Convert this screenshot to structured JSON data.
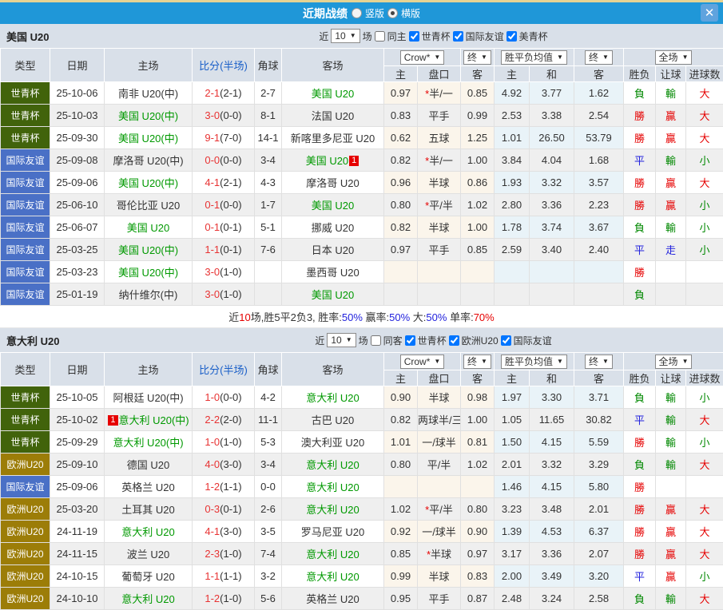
{
  "titlebar": {
    "title": "近期战绩",
    "radios": [
      {
        "label": "竖版",
        "checked": false
      },
      {
        "label": "横版",
        "checked": true
      }
    ],
    "close": "✕"
  },
  "columns": {
    "type": "类型",
    "date": "日期",
    "home": "主场",
    "score": "比分(半场)",
    "corner": "角球",
    "away": "客场",
    "sub": [
      "主",
      "盘口",
      "客",
      "主",
      "和",
      "客",
      "胜负",
      "让球",
      "进球数"
    ],
    "dropdowns": [
      "Crow*",
      "终",
      "胜平负均值",
      "终",
      "全场"
    ]
  },
  "colors": {
    "bar": "#1F97D8",
    "panel": "#D9E0E9",
    "stripe": "#EFEFEF",
    "cream": "#FBF5EB",
    "lightblue": "#E9F3F8",
    "team_green": "#009900",
    "score_red": "#E83333",
    "red": "#E60000",
    "green": "#008800",
    "blue": "#2222DD",
    "black": "#333333",
    "badge": "#E60000"
  },
  "type_colors": {
    "世青杯": "#41630B",
    "国际友谊": "#4A70C6",
    "欧洲U20": "#9C7D08"
  },
  "result_colors": {
    "勝": "red",
    "贏": "red",
    "大": "red",
    "負": "green",
    "輸": "green",
    "小": "green",
    "平": "blue",
    "走": "blue"
  },
  "sections": [
    {
      "team": "美国 U20",
      "filters": {
        "near": "近",
        "count": "10",
        "games": "场",
        "same": "同主",
        "same_checked": false,
        "comps": [
          "世青杯",
          "国际友谊",
          "美青杯"
        ]
      },
      "rows": [
        {
          "type": "世青杯",
          "date": "25-10-06",
          "home": "南非 U20(中)",
          "home_green": false,
          "score": "2-1",
          "half": "(2-1)",
          "corner": "2-7",
          "away": "美国 U20",
          "away_green": true,
          "pan": [
            "0.97",
            "*半/一",
            "0.85"
          ],
          "euro": [
            "4.92",
            "3.77",
            "1.62"
          ],
          "res": [
            "負",
            "輸",
            "大"
          ]
        },
        {
          "type": "世青杯",
          "date": "25-10-03",
          "home": "美国 U20(中)",
          "home_green": true,
          "score": "3-0",
          "half": "(0-0)",
          "corner": "8-1",
          "away": "法国 U20",
          "away_green": false,
          "pan": [
            "0.83",
            "平手",
            "0.99"
          ],
          "euro": [
            "2.53",
            "3.38",
            "2.54"
          ],
          "res": [
            "勝",
            "贏",
            "大"
          ]
        },
        {
          "type": "世青杯",
          "date": "25-09-30",
          "home": "美国 U20(中)",
          "home_green": true,
          "score": "9-1",
          "half": "(7-0)",
          "corner": "14-1",
          "away": "新喀里多尼亚 U20",
          "away_green": false,
          "pan": [
            "0.62",
            "五球",
            "1.25"
          ],
          "euro": [
            "1.01",
            "26.50",
            "53.79"
          ],
          "res": [
            "勝",
            "贏",
            "大"
          ]
        },
        {
          "type": "国际友谊",
          "date": "25-09-08",
          "home": "摩洛哥 U20(中)",
          "home_green": false,
          "score": "0-0",
          "half": "(0-0)",
          "corner": "3-4",
          "away": "美国 U20",
          "away_green": true,
          "away_badge": "1",
          "pan": [
            "0.82",
            "*半/一",
            "1.00"
          ],
          "euro": [
            "3.84",
            "4.04",
            "1.68"
          ],
          "res": [
            "平",
            "輸",
            "小"
          ]
        },
        {
          "type": "国际友谊",
          "date": "25-09-06",
          "home": "美国 U20(中)",
          "home_green": true,
          "score": "4-1",
          "half": "(2-1)",
          "corner": "4-3",
          "away": "摩洛哥 U20",
          "away_green": false,
          "pan": [
            "0.96",
            "半球",
            "0.86"
          ],
          "euro": [
            "1.93",
            "3.32",
            "3.57"
          ],
          "res": [
            "勝",
            "贏",
            "大"
          ]
        },
        {
          "type": "国际友谊",
          "date": "25-06-10",
          "home": "哥伦比亚 U20",
          "home_green": false,
          "score": "0-1",
          "half": "(0-0)",
          "corner": "1-7",
          "away": "美国 U20",
          "away_green": true,
          "pan": [
            "0.80",
            "*平/半",
            "1.02"
          ],
          "euro": [
            "2.80",
            "3.36",
            "2.23"
          ],
          "res": [
            "勝",
            "贏",
            "小"
          ]
        },
        {
          "type": "国际友谊",
          "date": "25-06-07",
          "home": "美国 U20",
          "home_green": true,
          "score": "0-1",
          "half": "(0-1)",
          "corner": "5-1",
          "away": "挪威 U20",
          "away_green": false,
          "pan": [
            "0.82",
            "半球",
            "1.00"
          ],
          "euro": [
            "1.78",
            "3.74",
            "3.67"
          ],
          "res": [
            "負",
            "輸",
            "小"
          ]
        },
        {
          "type": "国际友谊",
          "date": "25-03-25",
          "home": "美国 U20(中)",
          "home_green": true,
          "score": "1-1",
          "half": "(0-1)",
          "corner": "7-6",
          "away": "日本 U20",
          "away_green": false,
          "pan": [
            "0.97",
            "平手",
            "0.85"
          ],
          "euro": [
            "2.59",
            "3.40",
            "2.40"
          ],
          "res": [
            "平",
            "走",
            "小"
          ]
        },
        {
          "type": "国际友谊",
          "date": "25-03-23",
          "home": "美国 U20(中)",
          "home_green": true,
          "score": "3-0",
          "half": "(1-0)",
          "corner": "",
          "away": "墨西哥 U20",
          "away_green": false,
          "pan": [
            "",
            "",
            ""
          ],
          "euro": [
            "",
            "",
            ""
          ],
          "res": [
            "勝",
            "",
            ""
          ]
        },
        {
          "type": "国际友谊",
          "date": "25-01-19",
          "home": "纳什维尔(中)",
          "home_green": false,
          "score": "3-0",
          "half": "(1-0)",
          "corner": "",
          "away": "美国 U20",
          "away_green": true,
          "pan": [
            "",
            "",
            ""
          ],
          "euro": [
            "",
            "",
            ""
          ],
          "res": [
            "負",
            "",
            ""
          ]
        }
      ],
      "summary": [
        {
          "t": "近",
          "c": "black"
        },
        {
          "t": "10",
          "c": "red"
        },
        {
          "t": "场,胜5平2负3, 胜率:",
          "c": "black"
        },
        {
          "t": "50%",
          "c": "blue"
        },
        {
          "t": " 赢率:",
          "c": "black"
        },
        {
          "t": "50%",
          "c": "blue"
        },
        {
          "t": " 大:",
          "c": "black"
        },
        {
          "t": "50%",
          "c": "blue"
        },
        {
          "t": " 单率:",
          "c": "black"
        },
        {
          "t": "70%",
          "c": "red"
        }
      ]
    },
    {
      "team": "意大利 U20",
      "filters": {
        "near": "近",
        "count": "10",
        "games": "场",
        "same": "同客",
        "same_checked": false,
        "comps": [
          "世青杯",
          "欧洲U20",
          "国际友谊"
        ]
      },
      "rows": [
        {
          "type": "世青杯",
          "date": "25-10-05",
          "home": "阿根廷 U20(中)",
          "home_green": false,
          "score": "1-0",
          "half": "(0-0)",
          "corner": "4-2",
          "away": "意大利 U20",
          "away_green": true,
          "pan": [
            "0.90",
            "半球",
            "0.98"
          ],
          "euro": [
            "1.97",
            "3.30",
            "3.71"
          ],
          "res": [
            "負",
            "輸",
            "小"
          ]
        },
        {
          "type": "世青杯",
          "date": "25-10-02",
          "home": "意大利 U20(中)",
          "home_green": true,
          "home_badge": "1",
          "score": "2-2",
          "half": "(2-0)",
          "corner": "11-1",
          "away": "古巴 U20",
          "away_green": false,
          "pan": [
            "0.82",
            "两球半/三",
            "1.00"
          ],
          "euro": [
            "1.05",
            "11.65",
            "30.82"
          ],
          "res": [
            "平",
            "輸",
            "大"
          ]
        },
        {
          "type": "世青杯",
          "date": "25-09-29",
          "home": "意大利 U20(中)",
          "home_green": true,
          "score": "1-0",
          "half": "(1-0)",
          "corner": "5-3",
          "away": "澳大利亚 U20",
          "away_green": false,
          "pan": [
            "1.01",
            "一/球半",
            "0.81"
          ],
          "euro": [
            "1.50",
            "4.15",
            "5.59"
          ],
          "res": [
            "勝",
            "輸",
            "小"
          ]
        },
        {
          "type": "欧洲U20",
          "date": "25-09-10",
          "home": "德国 U20",
          "home_green": false,
          "score": "4-0",
          "half": "(3-0)",
          "corner": "3-4",
          "away": "意大利 U20",
          "away_green": true,
          "pan": [
            "0.80",
            "平/半",
            "1.02"
          ],
          "euro": [
            "2.01",
            "3.32",
            "3.29"
          ],
          "res": [
            "負",
            "輸",
            "大"
          ]
        },
        {
          "type": "国际友谊",
          "date": "25-09-06",
          "home": "英格兰 U20",
          "home_green": false,
          "score": "1-2",
          "half": "(1-1)",
          "corner": "0-0",
          "away": "意大利 U20",
          "away_green": true,
          "pan": [
            "",
            "",
            ""
          ],
          "euro": [
            "1.46",
            "4.15",
            "5.80"
          ],
          "res": [
            "勝",
            "",
            ""
          ]
        },
        {
          "type": "欧洲U20",
          "date": "25-03-20",
          "home": "土耳其 U20",
          "home_green": false,
          "score": "0-3",
          "half": "(0-1)",
          "corner": "2-6",
          "away": "意大利 U20",
          "away_green": true,
          "pan": [
            "1.02",
            "*平/半",
            "0.80"
          ],
          "euro": [
            "3.23",
            "3.48",
            "2.01"
          ],
          "res": [
            "勝",
            "贏",
            "大"
          ]
        },
        {
          "type": "欧洲U20",
          "date": "24-11-19",
          "home": "意大利 U20",
          "home_green": true,
          "score": "4-1",
          "half": "(3-0)",
          "corner": "3-5",
          "away": "罗马尼亚 U20",
          "away_green": false,
          "pan": [
            "0.92",
            "一/球半",
            "0.90"
          ],
          "euro": [
            "1.39",
            "4.53",
            "6.37"
          ],
          "res": [
            "勝",
            "贏",
            "大"
          ]
        },
        {
          "type": "欧洲U20",
          "date": "24-11-15",
          "home": "波兰 U20",
          "home_green": false,
          "score": "2-3",
          "half": "(1-0)",
          "corner": "7-4",
          "away": "意大利 U20",
          "away_green": true,
          "pan": [
            "0.85",
            "*半球",
            "0.97"
          ],
          "euro": [
            "3.17",
            "3.36",
            "2.07"
          ],
          "res": [
            "勝",
            "贏",
            "大"
          ]
        },
        {
          "type": "欧洲U20",
          "date": "24-10-15",
          "home": "葡萄牙 U20",
          "home_green": false,
          "score": "1-1",
          "half": "(1-1)",
          "corner": "3-2",
          "away": "意大利 U20",
          "away_green": true,
          "pan": [
            "0.99",
            "半球",
            "0.83"
          ],
          "euro": [
            "2.00",
            "3.49",
            "3.20"
          ],
          "res": [
            "平",
            "贏",
            "小"
          ]
        },
        {
          "type": "欧洲U20",
          "date": "24-10-10",
          "home": "意大利 U20",
          "home_green": true,
          "score": "1-2",
          "half": "(1-0)",
          "corner": "5-6",
          "away": "英格兰 U20",
          "away_green": false,
          "pan": [
            "0.95",
            "平手",
            "0.87"
          ],
          "euro": [
            "2.48",
            "3.24",
            "2.58"
          ],
          "res": [
            "負",
            "輸",
            "大"
          ]
        }
      ]
    }
  ]
}
